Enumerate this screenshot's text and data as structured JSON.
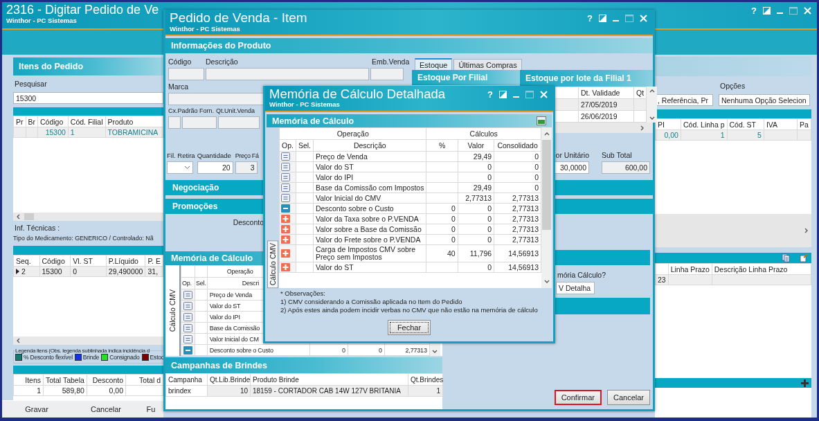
{
  "main": {
    "title": "2316 - Digitar Pedido de Ve",
    "subtitle": "Winthor - PC Sistemas",
    "help": "?",
    "items": {
      "title": "Itens do Pedido",
      "search_label": "Pesquisar",
      "search_value": "15300",
      "columns": [
        "Pr",
        "Br",
        "Código",
        "Cód. Filial",
        "Produto"
      ],
      "rows": [
        {
          "code": "15300",
          "branch": "1",
          "product": "TOBRAMICINA"
        }
      ]
    },
    "tech_label": "Inf. Técnicas :",
    "tech_info": "Tipo do Medicamento: GENERICO / Controlado: Nã",
    "seq_table": {
      "columns": [
        "Seq.",
        "Código",
        "Vl. ST",
        "P.Líquido",
        "P. E"
      ],
      "rows": [
        {
          "selected": true,
          "cells": [
            "2",
            "15300",
            "0",
            "29,490000",
            "31,"
          ]
        }
      ]
    },
    "legend": {
      "title": "Legenda itens (Obs. legenda sublinhada indica incidência d",
      "items": [
        {
          "label": "% Desconto flexível",
          "color": "#0e7c70"
        },
        {
          "label": "Brinde",
          "color": "#1430e8"
        },
        {
          "label": "Consignado",
          "color": "#22e022"
        },
        {
          "label": "Estoq",
          "color": "#7a0000"
        }
      ]
    },
    "totals": {
      "columns": [
        "Itens",
        "Total Tabela",
        "Desconto",
        "Total d"
      ],
      "rows": [
        [
          "1",
          "589,80",
          "0,00"
        ]
      ]
    },
    "buttons": [
      "Gravar",
      "Cancelar",
      "Fu"
    ],
    "right": {
      "search_by": ", Referência, Pr",
      "options_label": "Opções",
      "options_value": "Nenhuma Opção Selecion",
      "columns": [
        "PI",
        "Cód. Linha p",
        "Cód. ST",
        "IVA",
        "Pa"
      ],
      "rows": [
        [
          "0,00",
          "1",
          "5"
        ]
      ],
      "term_columns": [
        "Linha Prazo",
        "Descrição Linha Prazo"
      ],
      "term_rows": [
        [
          "23"
        ]
      ]
    }
  },
  "item_window": {
    "title": "Pedido de Venda - Item",
    "subtitle": "Winthor - PC Sistemas",
    "help": "?",
    "product_info": {
      "title": "Informações do Produto",
      "code_label": "Código",
      "description_label": "Descrição",
      "package_label": "Emb.Venda",
      "brand_label": "Marca",
      "supplier_box_label": "Cx.Padrão Forn.",
      "unit_qty_label": "Qt.Unit.Venda"
    },
    "tabs": [
      {
        "label": "Estoque",
        "selected": true
      },
      {
        "label": "Últimas Compras",
        "selected": false
      }
    ],
    "stock_branch_title": "Estoque Por Filial",
    "stock_lot": {
      "title": "Estoque por lote da Filial 1",
      "columns": [
        "Dt. Validade",
        "Qt"
      ],
      "rows": [
        "27/05/2019",
        "26/06/2019"
      ]
    },
    "order": {
      "branch_label": "Fil. Retira",
      "qty_label": "Quantidade",
      "qty_value": "20",
      "price_label": "Preço Fá",
      "price_value": "3",
      "unit_label": "or Unitário",
      "unit_value": "30,0000",
      "subtotal_label": "Sub Total",
      "subtotal_value": "600,00"
    },
    "sections": [
      "Negociação",
      "Promoções"
    ],
    "discount_label": "Desconto",
    "calc": {
      "title": "Memória de Cálculo",
      "tab": "Cálculo CMV",
      "group": "Operação",
      "columns": [
        "Op.",
        "Sel.",
        "Descri"
      ],
      "rows": [
        {
          "kind": "equal",
          "desc": "Preço de Venda"
        },
        {
          "kind": "equal",
          "desc": "Valor do ST"
        },
        {
          "kind": "equal",
          "desc": "Valor do IPI"
        },
        {
          "kind": "equal",
          "desc": "Base da Comissão"
        },
        {
          "kind": "equal",
          "desc": "Valor Inicial do CM"
        },
        {
          "kind": "minus",
          "desc": "Desconto sobre o Custo",
          "pct": "0",
          "value": "0",
          "total": "2,77313"
        }
      ]
    },
    "calc_option": {
      "label": "mória Cálculo?",
      "value": "V Detalha"
    },
    "campaigns": {
      "title": "Campanhas de Brindes",
      "columns": [
        "Campanha",
        "Qt.Lib.Brinde",
        "Produto Brinde",
        "Qt.Brindes"
      ],
      "rows": [
        [
          "brindex",
          "10",
          "18159 - CORTADOR CAB 14W 127V BRITANIA",
          "1"
        ]
      ]
    },
    "buttons": [
      {
        "label": "Confirmar",
        "highlighted": true
      },
      {
        "label": "Cancelar",
        "highlighted": false
      }
    ]
  },
  "dialog": {
    "title": "Memória de Cálculo Detalhada",
    "subtitle": "Winthor - PC Sistemas",
    "help": "?",
    "section": "Memória de Cálculo",
    "tab": "Cálculo CMV",
    "groups": [
      "Operação",
      "Cálculos"
    ],
    "columns": [
      "Op.",
      "Sel.",
      "Descrição",
      "%",
      "Valor",
      "Consolidado"
    ],
    "rows": [
      {
        "kind": "equal",
        "desc": "Preço de Venda",
        "value": "29,49",
        "total": "0"
      },
      {
        "kind": "equal",
        "desc": "Valor do ST",
        "value": "0",
        "total": "0"
      },
      {
        "kind": "equal",
        "desc": "Valor do IPI",
        "value": "0",
        "total": "0"
      },
      {
        "kind": "equal",
        "desc": "Base da Comissão com Impostos",
        "value": "29,49",
        "total": "0"
      },
      {
        "kind": "equal",
        "desc": "Valor Inicial do CMV",
        "value": "2,77313",
        "total": "2,77313"
      },
      {
        "kind": "minus",
        "desc": "Desconto sobre o Custo",
        "pct": "0",
        "value": "0",
        "total": "2,77313"
      },
      {
        "kind": "plus",
        "desc": "Valor da Taxa sobre o P.VENDA",
        "pct": "0",
        "value": "0",
        "total": "2,77313"
      },
      {
        "kind": "plus",
        "desc": "Valor sobre a Base da Comissão",
        "pct": "0",
        "value": "0",
        "total": "2,77313"
      },
      {
        "kind": "plus",
        "desc": "Valor do Frete sobre o P.VENDA",
        "pct": "0",
        "value": "0",
        "total": "2,77313"
      },
      {
        "kind": "plus",
        "desc": "Carga de Impostos CMV sobre Preço sem Impostos",
        "pct": "40",
        "value": "11,796",
        "total": "14,56913"
      },
      {
        "kind": "plus",
        "desc": "Valor do ST",
        "value": "0",
        "total": "14,56913"
      }
    ],
    "notes": [
      "* Observações:",
      "1) CMV considerando a Comissão aplicada no Item do Pedido",
      "2) Após estes ainda podem incidir verbas no CMV que não estão na memória de cálculo"
    ],
    "button": "Fechar"
  }
}
